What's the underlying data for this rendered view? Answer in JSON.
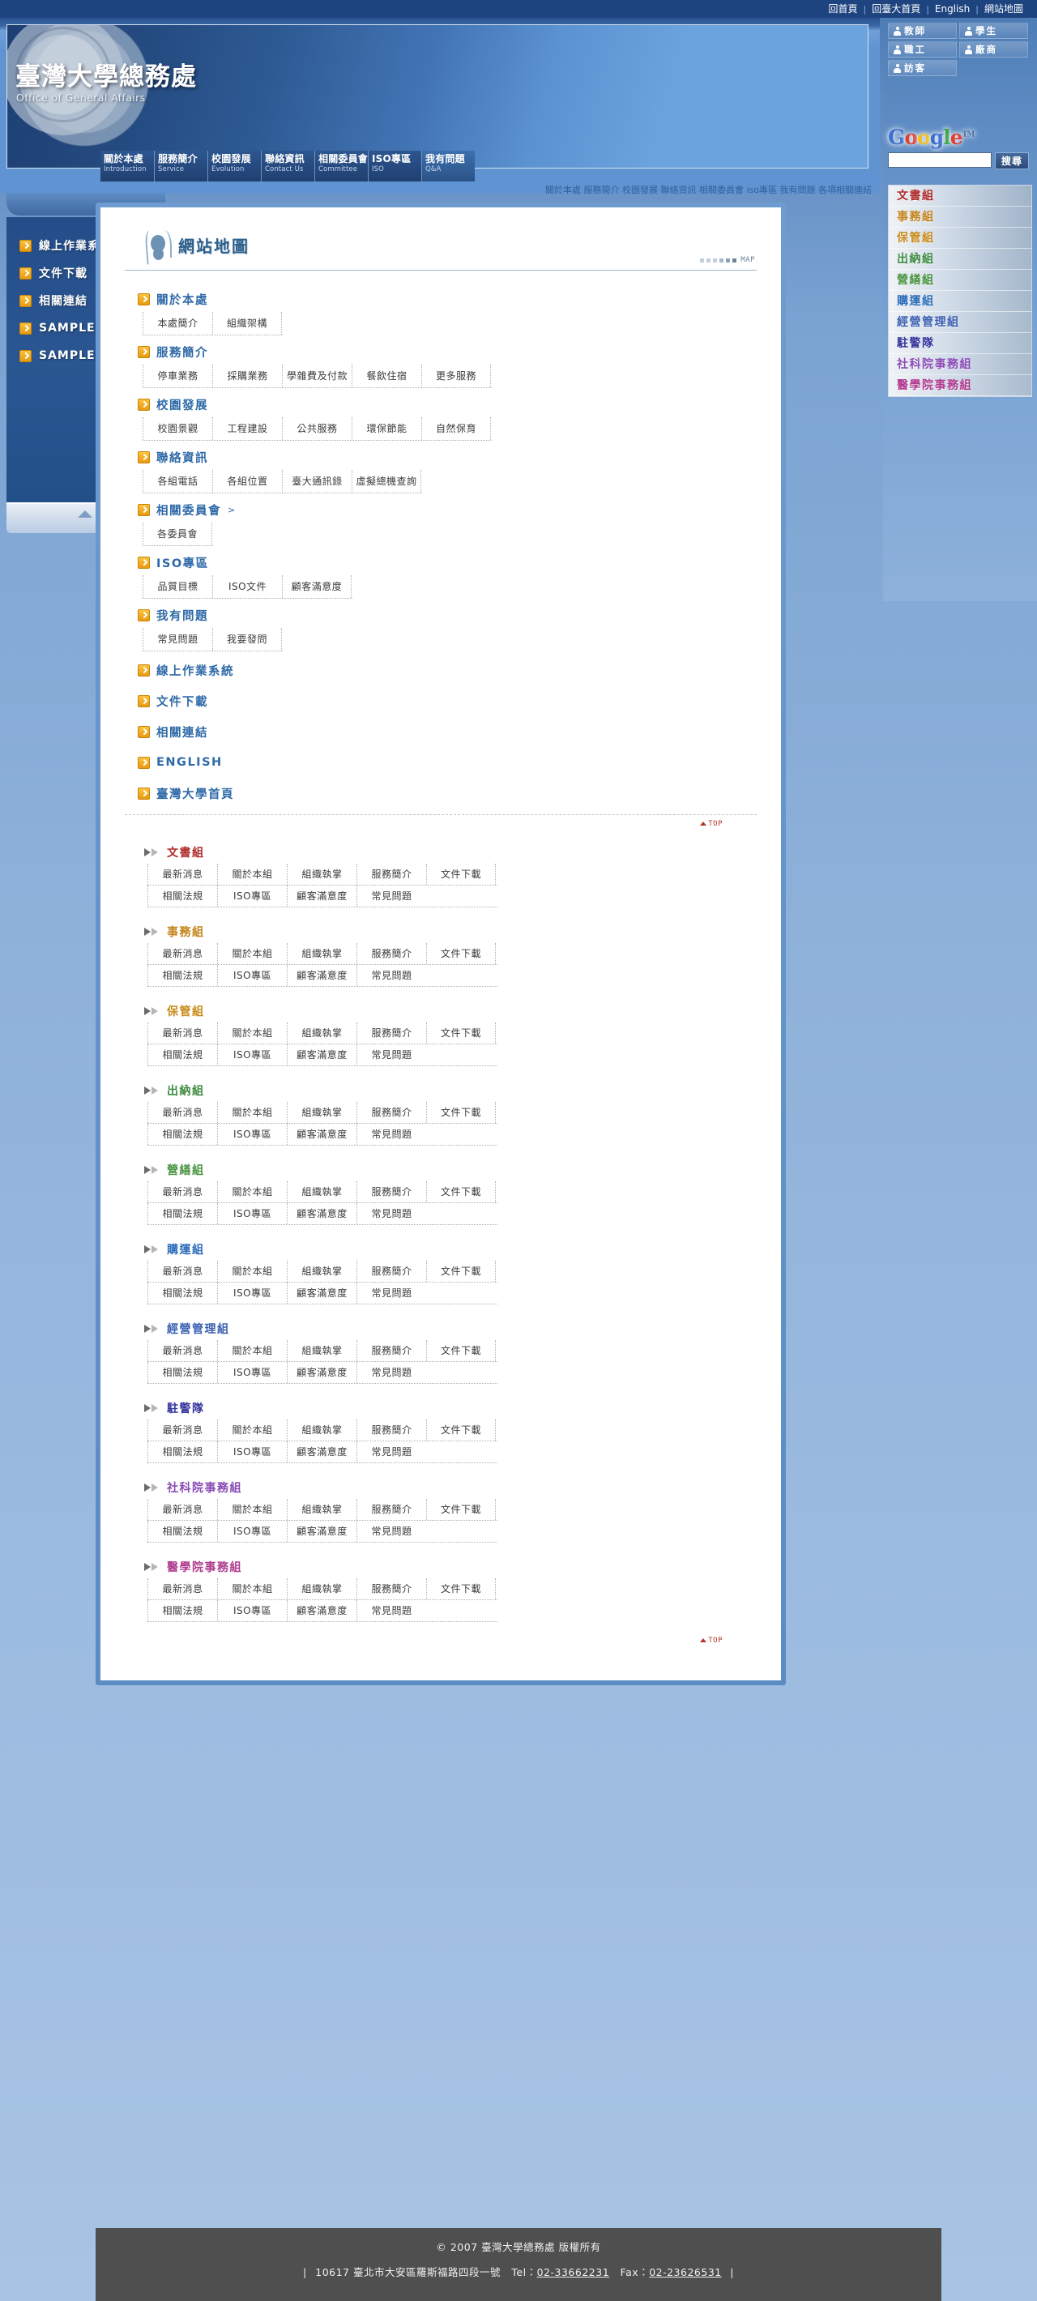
{
  "topbar": {
    "links": [
      "回首頁",
      "回臺大首頁",
      "English",
      "網站地圖"
    ],
    "separator": "|"
  },
  "banner": {
    "logo_zh": "臺灣大學總務處",
    "logo_en": "Office of General Affairs"
  },
  "mainnav": [
    {
      "zh": "關於本處",
      "en": "Introduction",
      "active": false
    },
    {
      "zh": "服務簡介",
      "en": "Service",
      "active": false
    },
    {
      "zh": "校園發展",
      "en": "Evolution",
      "active": false
    },
    {
      "zh": "聯絡資訊",
      "en": "Contact Us",
      "active": false
    },
    {
      "zh": "相關委員會",
      "en": "Committee",
      "active": false
    },
    {
      "zh": "ISO專區",
      "en": "ISO",
      "active": false
    },
    {
      "zh": "我有問題",
      "en": "Q&A",
      "active": true
    }
  ],
  "keyword_strip": "關於本處 服務簡介 校園發展 聯絡資訊 相關委員會 iso專區 我有問題 各項相關連結",
  "right_panel": {
    "roles": [
      "教師",
      "學生",
      "職工",
      "廠商",
      "訪客"
    ],
    "google": {
      "logo_letters": [
        {
          "c": "G",
          "color": "#3a6fd0"
        },
        {
          "c": "o",
          "color": "#e03f32"
        },
        {
          "c": "o",
          "color": "#f3bb1c"
        },
        {
          "c": "g",
          "color": "#3a6fd0"
        },
        {
          "c": "l",
          "color": "#3aa545"
        },
        {
          "c": "e",
          "color": "#e03f32"
        }
      ],
      "trademark": "TM",
      "search_value": "",
      "search_placeholder": "",
      "search_button": "搜尋"
    },
    "departments": [
      {
        "label": "文書組",
        "color": "#b02a2a"
      },
      {
        "label": "事務組",
        "color": "#c4841b"
      },
      {
        "label": "保管組",
        "color": "#c98b18"
      },
      {
        "label": "出納組",
        "color": "#3e8c42"
      },
      {
        "label": "營繕組",
        "color": "#47933f"
      },
      {
        "label": "購運組",
        "color": "#2b6cb8"
      },
      {
        "label": "經營管理組",
        "color": "#3a5fb0"
      },
      {
        "label": "駐警隊",
        "color": "#33349c"
      },
      {
        "label": "社科院事務組",
        "color": "#8a4bb5"
      },
      {
        "label": "醫學院事務組",
        "color": "#b03a8e"
      }
    ]
  },
  "left_sidebar": {
    "items": [
      "線上作業系統",
      "文件下載",
      "相關連結",
      "SAMPLE",
      "SAMPLE"
    ]
  },
  "page": {
    "title": "網站地圖",
    "map_label": "MAP",
    "top_label": "TOP"
  },
  "sitemap": {
    "sections": [
      {
        "title": "關於本處",
        "suffix": "",
        "links": [
          "本處簡介",
          "組織架構"
        ]
      },
      {
        "title": "服務簡介",
        "suffix": "",
        "links": [
          "停車業務",
          "採購業務",
          "學雜費及付款",
          "餐飲住宿",
          "更多服務"
        ]
      },
      {
        "title": "校園發展",
        "suffix": "",
        "links": [
          "校園景觀",
          "工程建設",
          "公共服務",
          "環保節能",
          "自然保育"
        ]
      },
      {
        "title": "聯絡資訊",
        "suffix": "",
        "links": [
          "各組電話",
          "各組位置",
          "臺大通訊錄",
          "虛擬總機查詢"
        ]
      },
      {
        "title": "相關委員會",
        "suffix": ">",
        "links": [
          "各委員會"
        ]
      },
      {
        "title": "ISO專區",
        "suffix": "",
        "links": [
          "品質目標",
          "ISO文件",
          "顧客滿意度"
        ]
      },
      {
        "title": "我有問題",
        "suffix": "",
        "links": [
          "常見問題",
          "我要發問"
        ]
      },
      {
        "title": "線上作業系統",
        "suffix": "",
        "links": []
      },
      {
        "title": "文件下載",
        "suffix": "",
        "links": []
      },
      {
        "title": "相關連結",
        "suffix": "",
        "links": []
      },
      {
        "title": "ENGLISH",
        "suffix": "",
        "links": []
      },
      {
        "title": "臺灣大學首頁",
        "suffix": "",
        "links": []
      }
    ]
  },
  "dept_sections": {
    "row1": [
      "最新消息",
      "關於本組",
      "組織執掌",
      "服務簡介",
      "文件下載"
    ],
    "row2": [
      "相關法規",
      "ISO專區",
      "顧客滿意度",
      "常見問題"
    ],
    "items": [
      {
        "title": "文書組",
        "color": "#b02a2a"
      },
      {
        "title": "事務組",
        "color": "#c4841b"
      },
      {
        "title": "保管組",
        "color": "#c98b18"
      },
      {
        "title": "出納組",
        "color": "#3e8c42"
      },
      {
        "title": "營繕組",
        "color": "#47933f"
      },
      {
        "title": "購運組",
        "color": "#2b6cb8"
      },
      {
        "title": "經營管理組",
        "color": "#3a5fb0"
      },
      {
        "title": "駐警隊",
        "color": "#33349c"
      },
      {
        "title": "社科院事務組",
        "color": "#8a4bb5"
      },
      {
        "title": "醫學院事務組",
        "color": "#b03a8e"
      }
    ]
  },
  "footer": {
    "copyright": "© 2007 臺灣大學總務處 版權所有",
    "bar": "|",
    "address": "10617 臺北市大安區羅斯福路四段一號",
    "tel_label": "Tel：",
    "tel": "02-33662231",
    "fax_label": "Fax：",
    "fax": "02-23626531"
  }
}
